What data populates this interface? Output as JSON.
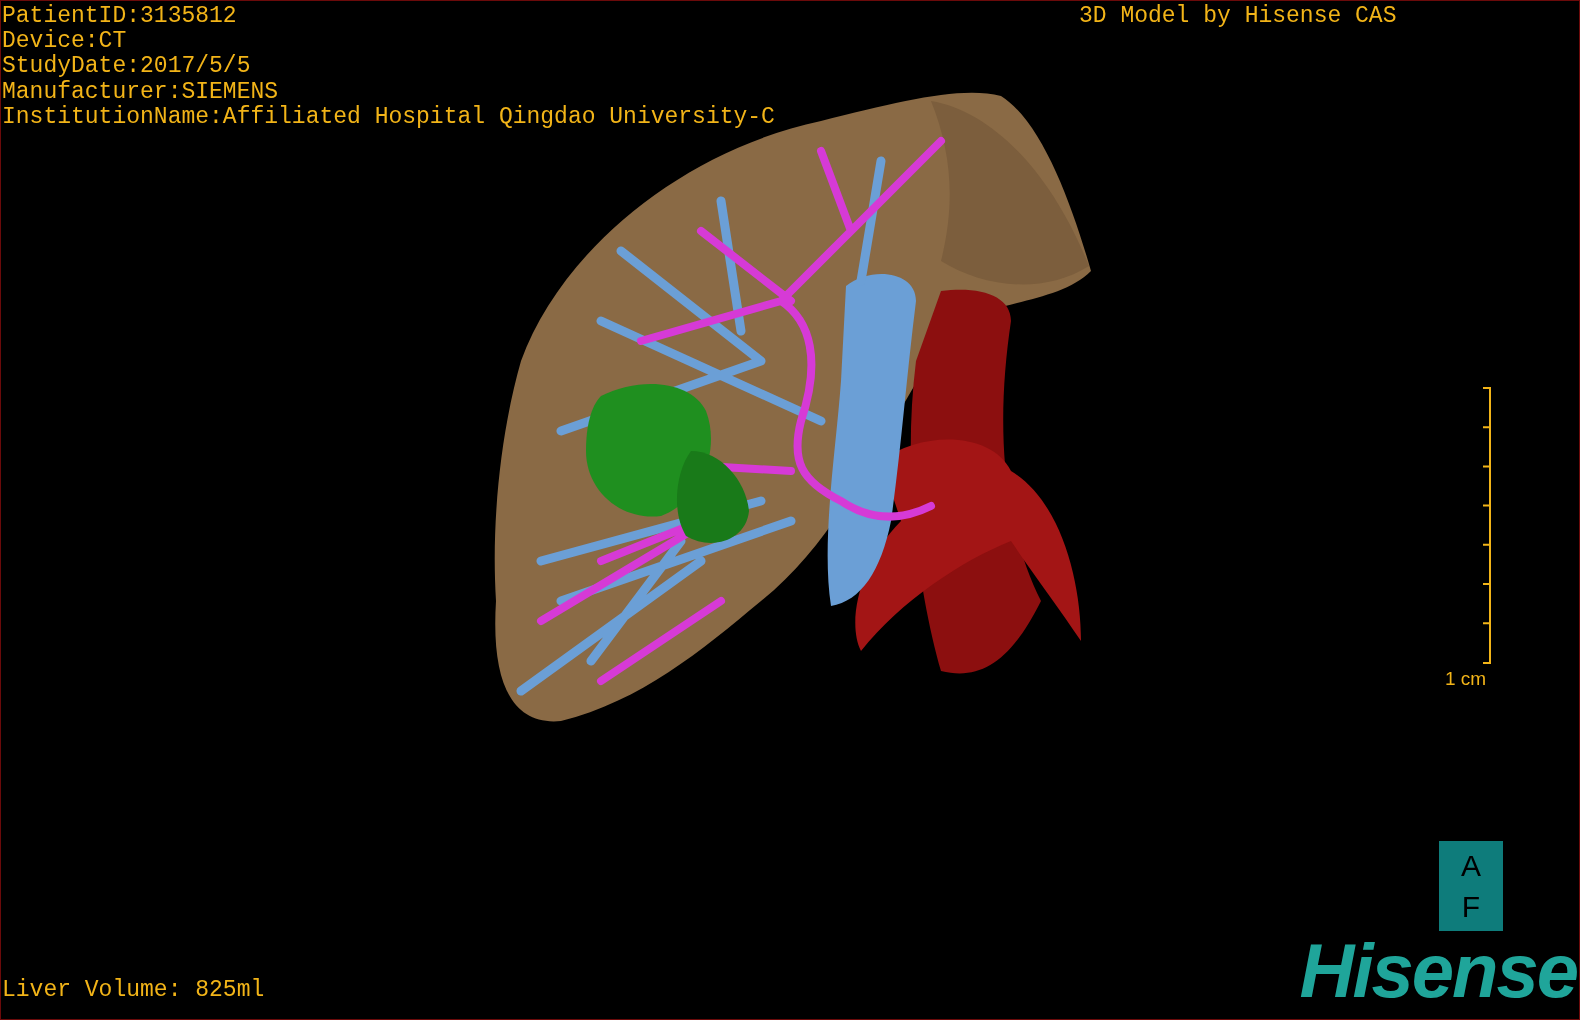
{
  "patient_info": [
    "PatientID:3135812",
    "Device:CT",
    "StudyDate:2017/5/5",
    "Manufacturer:SIEMENS",
    "InstitutionName:Affiliated Hospital Qingdao University-C"
  ],
  "title": "3D Model by Hisense CAS",
  "scale_bar": {
    "label": "1 cm"
  },
  "orientation_cube": {
    "labels": [
      "A",
      "F"
    ]
  },
  "logo": "Hisense",
  "liver_volume": "Liver Volume: 825ml"
}
